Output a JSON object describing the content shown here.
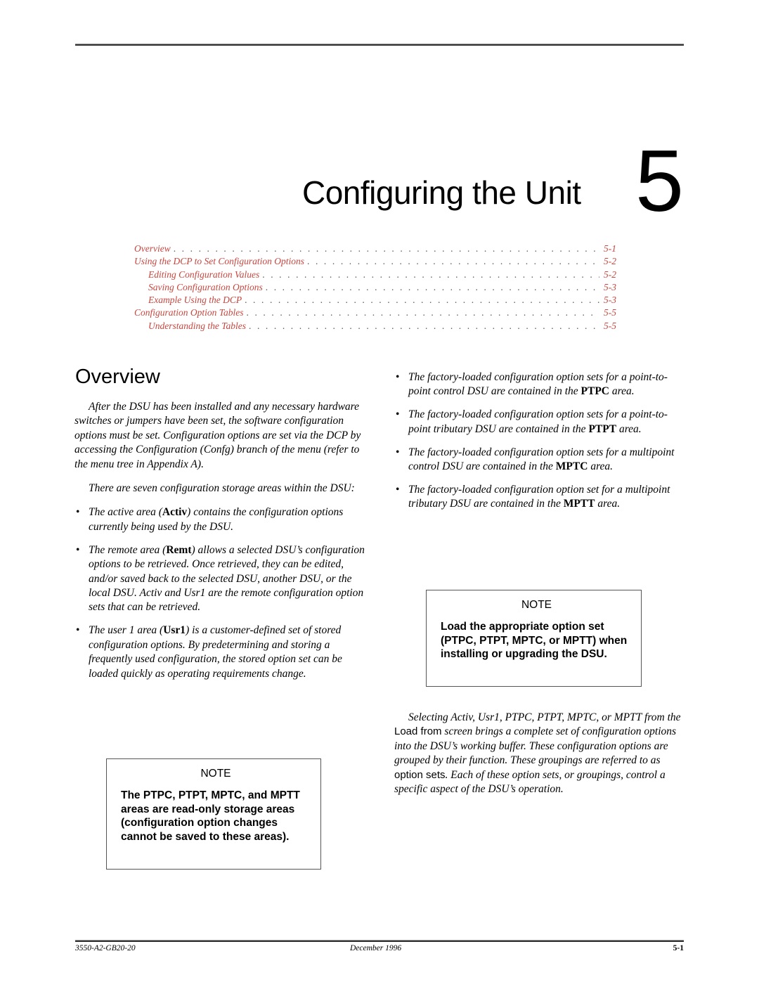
{
  "chapter": {
    "title": "Configuring the Unit",
    "number": "5"
  },
  "toc": [
    {
      "label": "Overview",
      "page": "5-1",
      "level": 1
    },
    {
      "label": "Using the DCP to Set Configuration Options",
      "page": "5-2",
      "level": 1
    },
    {
      "label": "Editing Configuration Values",
      "page": "5-2",
      "level": 2
    },
    {
      "label": "Saving Configuration Options",
      "page": "5-3",
      "level": 2
    },
    {
      "label": "Example Using the DCP",
      "page": "5-3",
      "level": 2
    },
    {
      "label": "Configuration Option Tables",
      "page": "5-5",
      "level": 1
    },
    {
      "label": "Understanding the Tables",
      "page": "5-5",
      "level": 2
    }
  ],
  "colors": {
    "toc_link": "#c8463e",
    "text": "#000000"
  },
  "section": {
    "title": "Overview",
    "intro": "After the DSU has been installed and any necessary hardware switches or jumpers have been set, the software configuration options must be set. Configuration options are set via the DCP by accessing the Configuration (Confg) branch of the menu (refer to the menu tree in Appendix A).",
    "storage_intro": "There are seven configuration storage areas within the DSU:",
    "left_bullets": [
      {
        "pre": "The active area (",
        "bold": "Activ",
        "post": ") contains the configuration options currently being used by the DSU."
      },
      {
        "pre": "The remote area (",
        "bold": "Remt",
        "post": ") allows a selected DSU’s configuration options to be retrieved. Once retrieved, they can be edited, and/or saved back to the selected DSU, another DSU, or the local DSU. Activ and Usr1 are the remote configuration option sets that can be retrieved."
      },
      {
        "pre": "The user 1 area (",
        "bold": "Usr1",
        "post": ") is a customer-defined set of stored configuration options. By predetermining and storing a frequently used configuration, the stored option set can be loaded quickly as operating requirements change."
      }
    ],
    "right_bullets": [
      {
        "pre": "The factory-loaded configuration option sets for a point-to-point control DSU are contained in the ",
        "bold": "PTPC",
        "post": " area."
      },
      {
        "pre": "The factory-loaded configuration option sets for a point-to-point tributary DSU are contained in the ",
        "bold": "PTPT",
        "post": " area."
      },
      {
        "pre": "The factory-loaded configuration option sets for a multipoint control DSU are contained in the ",
        "bold": "MPTC",
        "post": " area."
      },
      {
        "pre": "The factory-loaded configuration option set for a multipoint tributary DSU are contained in the ",
        "bold": "MPTT",
        "post": " area."
      }
    ],
    "note_left": {
      "heading": "NOTE",
      "body": "The PTPC, PTPT, MPTC, and MPTT areas are read-only storage areas (configuration option changes cannot be saved to these areas)."
    },
    "note_right": {
      "heading": "NOTE",
      "body": "Load the appropriate option set (PTPC, PTPT, MPTC, or MPTT) when installing or upgrading the DSU."
    },
    "closing": {
      "part1": "Selecting Activ, Usr1, PTPC, PTPT, MPTC, or MPTT from the ",
      "screen_name": "Load from",
      "part2": " screen brings a complete set of configuration options into the DSU’s working buffer. These configuration options are grouped by their function. These groupings are referred to as ",
      "term": "option sets",
      "part3": ". Each of these option sets, or groupings, control a specific aspect of the DSU’s operation."
    }
  },
  "footer": {
    "doc_number": "3550-A2-GB20-20",
    "date": "December 1996",
    "page": "5-1"
  }
}
